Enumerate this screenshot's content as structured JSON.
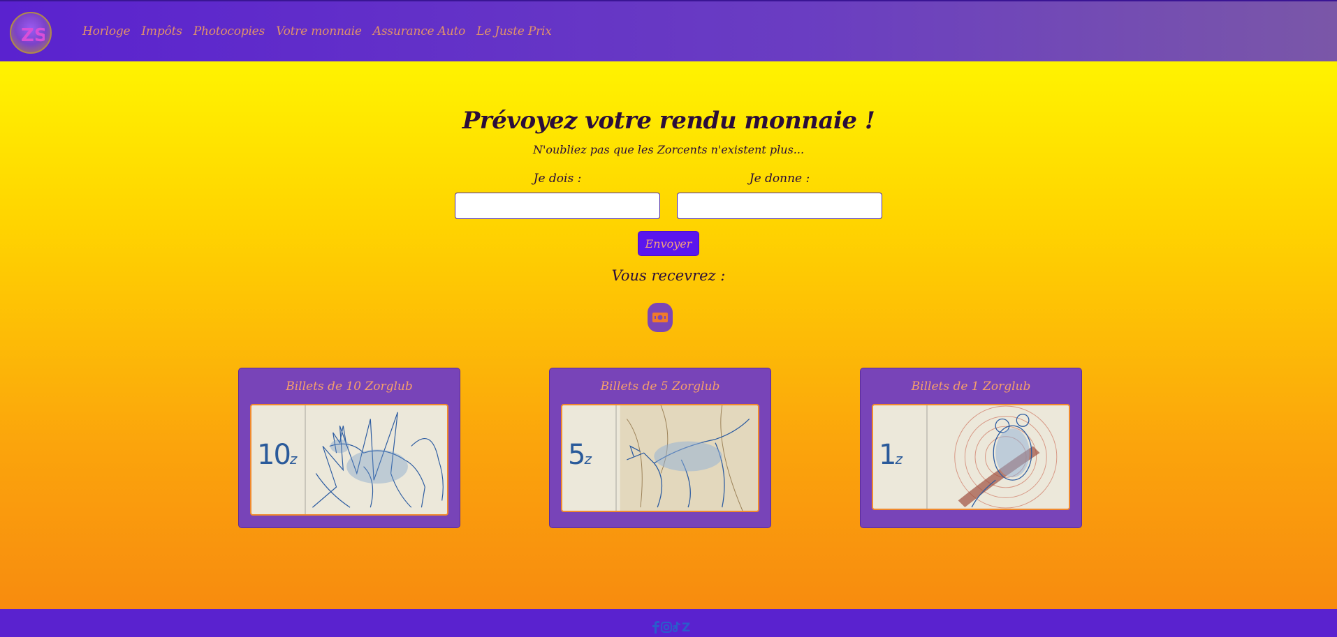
{
  "header": {
    "logo_text": "ZS",
    "nav": [
      {
        "label": "Horloge"
      },
      {
        "label": "Impôts"
      },
      {
        "label": "Photocopies"
      },
      {
        "label": "Votre monnaie"
      },
      {
        "label": "Assurance Auto"
      },
      {
        "label": "Le Juste Prix"
      }
    ]
  },
  "main": {
    "title": "Prévoyez votre rendu monnaie !",
    "subtitle": "N'oubliez pas que les Zorcents n'existent plus...",
    "owe": {
      "label": "Je dois :",
      "value": "",
      "placeholder": ""
    },
    "give": {
      "label": "Je donne :",
      "value": "",
      "placeholder": ""
    },
    "submit_label": "Envoyer",
    "result_label": "Vous recevrez :",
    "result_icon": "money-icon"
  },
  "cards": [
    {
      "title": "Billets de 10 Zorglub",
      "note_value": "10",
      "note_unit": "z",
      "animal": "deer"
    },
    {
      "title": "Billets de 5 Zorglub",
      "note_value": "5",
      "note_unit": "z",
      "animal": "fox"
    },
    {
      "title": "Billets de 1 Zorglub",
      "note_value": "1",
      "note_unit": "z",
      "animal": "mouse"
    }
  ],
  "footer": {
    "icons": [
      "facebook-icon",
      "instagram-icon",
      "tiktok-icon",
      "zorglub-icon"
    ],
    "last_icon_text": "Z"
  },
  "colors": {
    "header": "#5a22cf",
    "nav_text": "#e0926a",
    "button": "#5a16ee",
    "card": "#7844b8",
    "card_title": "#f6a06a",
    "gradient_top": "#ffff00",
    "gradient_bottom": "#f7870f"
  }
}
